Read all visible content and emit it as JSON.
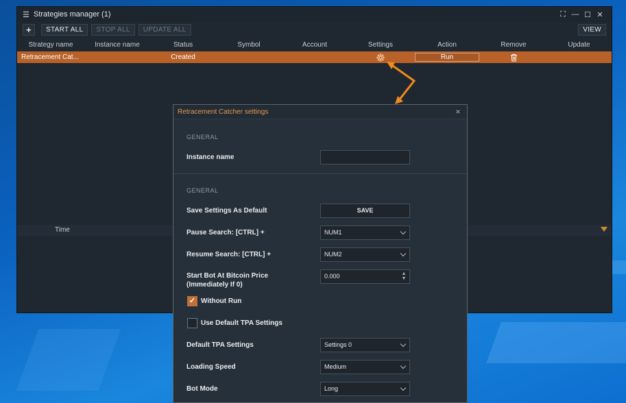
{
  "window": {
    "title": "Strategies manager (1)",
    "controls": [
      "expand-icon",
      "minimize-icon",
      "maximize-icon",
      "close-icon"
    ]
  },
  "toolbar": {
    "add_label": "+",
    "start_all": "START ALL",
    "stop_all": "STOP ALL",
    "update_all": "UPDATE ALL",
    "view": "VIEW"
  },
  "table": {
    "columns": [
      "Strategy name",
      "Instance name",
      "Status",
      "Symbol",
      "Account",
      "Settings",
      "Action",
      "Remove",
      "Update"
    ],
    "rows": [
      {
        "strategy_name": "Retracement Cat...",
        "instance_name": "",
        "status": "Created",
        "symbol": "",
        "account": "",
        "settings_icon": "gear-icon",
        "action": "Run",
        "remove_icon": "trash-icon",
        "update": ""
      }
    ]
  },
  "log": {
    "time_header": "Time"
  },
  "dialog": {
    "title": "Retracement Catcher settings",
    "section1": "GENERAL",
    "instance_name_label": "Instance name",
    "instance_name_value": "",
    "section2": "GENERAL",
    "save_default_label": "Save Settings As Default",
    "save_button": "SAVE",
    "pause_label": "Pause Search: [CTRL] +",
    "pause_value": "NUM1",
    "resume_label": "Resume Search: [CTRL] +",
    "resume_value": "NUM2",
    "start_bot_label_1": "Start Bot At Bitcoin Price",
    "start_bot_label_2": "(Immediately If 0)",
    "start_bot_value": "0.000",
    "without_run_label": "Without Run",
    "without_run_checked": true,
    "use_default_tpa_label": "Use Default TPA Settings",
    "use_default_tpa_checked": false,
    "default_tpa_label": "Default TPA Settings",
    "default_tpa_value": "Settings 0",
    "loading_speed_label": "Loading Speed",
    "loading_speed_value": "Medium",
    "bot_mode_label": "Bot Mode",
    "bot_mode_value": "Long"
  },
  "colors": {
    "accent": "#e49a52",
    "row_highlight": "#b8622a",
    "arrow": "#f08a1c",
    "window_bg": "#1f2730"
  }
}
